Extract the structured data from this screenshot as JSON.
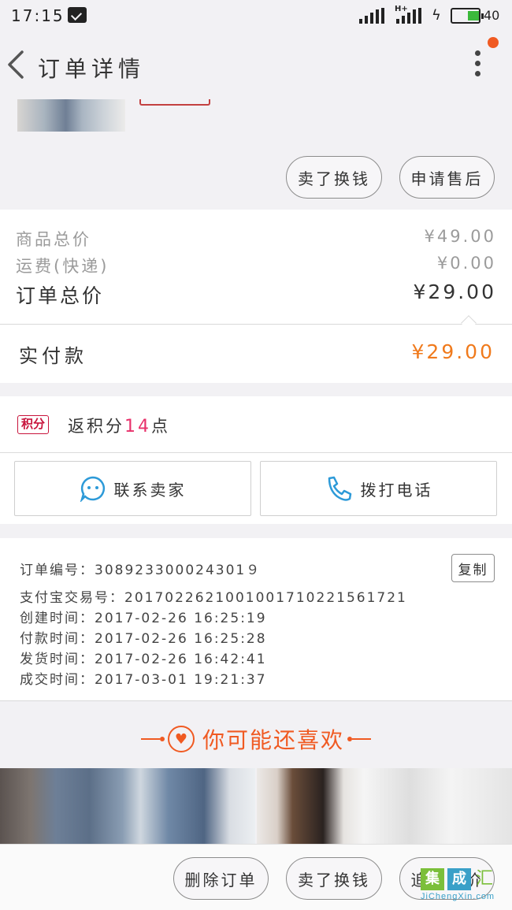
{
  "status_bar": {
    "time": "17:15",
    "network": "H+",
    "battery_level": 0.4,
    "battery_text": "40",
    "battery_color": "#3bb93b"
  },
  "header": {
    "title": "订单详情"
  },
  "product": {
    "actions": [
      "卖了换钱",
      "申请售后"
    ]
  },
  "prices": {
    "goods_total_label": "商品总价",
    "goods_total_value": "¥49.00",
    "shipping_label": "运费(快递)",
    "shipping_value": "¥0.00",
    "order_total_label": "订单总价",
    "order_total_value": "¥29.00",
    "paid_label": "实付款",
    "paid_value": "¥29.00",
    "paid_color": "#f07a1c"
  },
  "points": {
    "badge": "积分",
    "text_prefix": "返积分",
    "amount": "14",
    "text_suffix": "点"
  },
  "contact": {
    "seller_label": "联系卖家",
    "phone_label": "拨打电话"
  },
  "order_info": {
    "copy_label": "复制",
    "lines": [
      "订单编号：308923300024301９",
      "支付宝交易号：2017022621001001710221561721",
      "创建时间：2017-02-26  16:25:19",
      "付款时间：2017-02-26  16:25:28",
      "发货时间：2017-02-26  16:42:41",
      "成交时间：2017-03-01  19:21:37"
    ]
  },
  "recommend": {
    "title": "你可能还喜欢",
    "accent": "#f05a22"
  },
  "bottom_bar": {
    "actions": [
      "删除订单",
      "卖了换钱",
      "追加评价"
    ]
  },
  "watermark": {
    "chars": [
      "集",
      "成",
      "汇"
    ],
    "url": "JiChengXin.com"
  }
}
